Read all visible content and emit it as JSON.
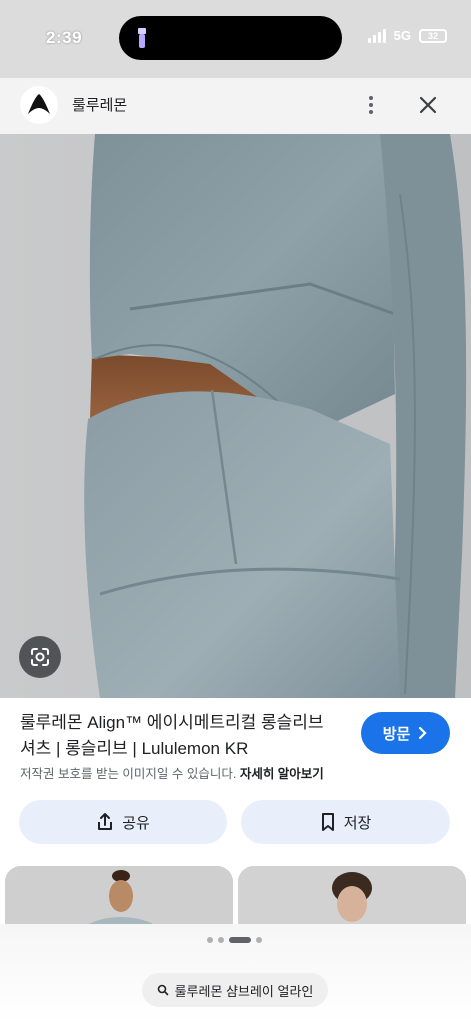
{
  "status_bar": {
    "time": "2:39",
    "network": "5G",
    "battery": "32"
  },
  "header": {
    "brand": "룰루레몬"
  },
  "product": {
    "title_line1": "룰루레몬 Align™ 에이시메트리컬 롱슬리브",
    "title_line2": "셔츠 | 롱슬리브 | Lululemon KR",
    "visit_label": "방문",
    "copyright_text": "저작권 보호를 받는 이미지일 수 있습니다.",
    "learn_more": "자세히 알아보기"
  },
  "actions": {
    "share_label": "공유",
    "save_label": "저장"
  },
  "bottom": {
    "search_chip": "룰루레몬 샴브레이 얼라인"
  },
  "colors": {
    "accent": "#1a73e8",
    "chip_bg": "#e8effb",
    "garment": "#8a9ba3"
  }
}
